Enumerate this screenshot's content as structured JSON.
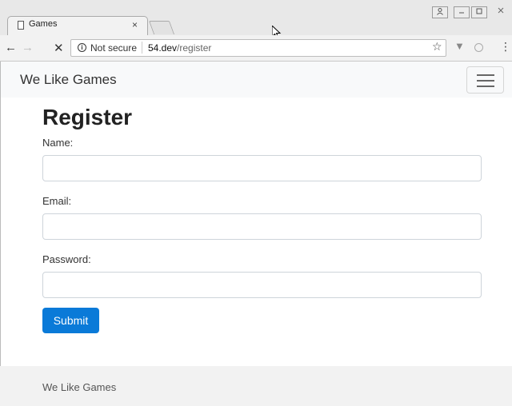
{
  "browser": {
    "tab_title": "Games",
    "tab_close": "×",
    "security_label": "Not secure",
    "url_host": "54.dev",
    "url_path": "/register",
    "back_glyph": "←",
    "forward_glyph": "→",
    "stop_glyph": "✕",
    "info_glyph": "i",
    "star_glyph": "☆",
    "ext1_glyph": "▼",
    "menu_glyph": "⋮",
    "window_controls": {
      "profile": "👤",
      "minimize": "—",
      "maximize": "▢",
      "close": "✕"
    }
  },
  "navbar": {
    "brand": "We Like Games",
    "toggler_icon": "hamburger-icon"
  },
  "form": {
    "title": "Register",
    "name_label": "Name:",
    "email_label": "Email:",
    "password_label": "Password:",
    "name_value": "",
    "email_value": "",
    "password_value": "",
    "submit_label": "Submit"
  },
  "footer": {
    "text": "We Like Games"
  },
  "colors": {
    "accent": "#0a7ad8",
    "navbar_bg": "#f8f9fa",
    "footer_bg": "#f2f2f2"
  }
}
